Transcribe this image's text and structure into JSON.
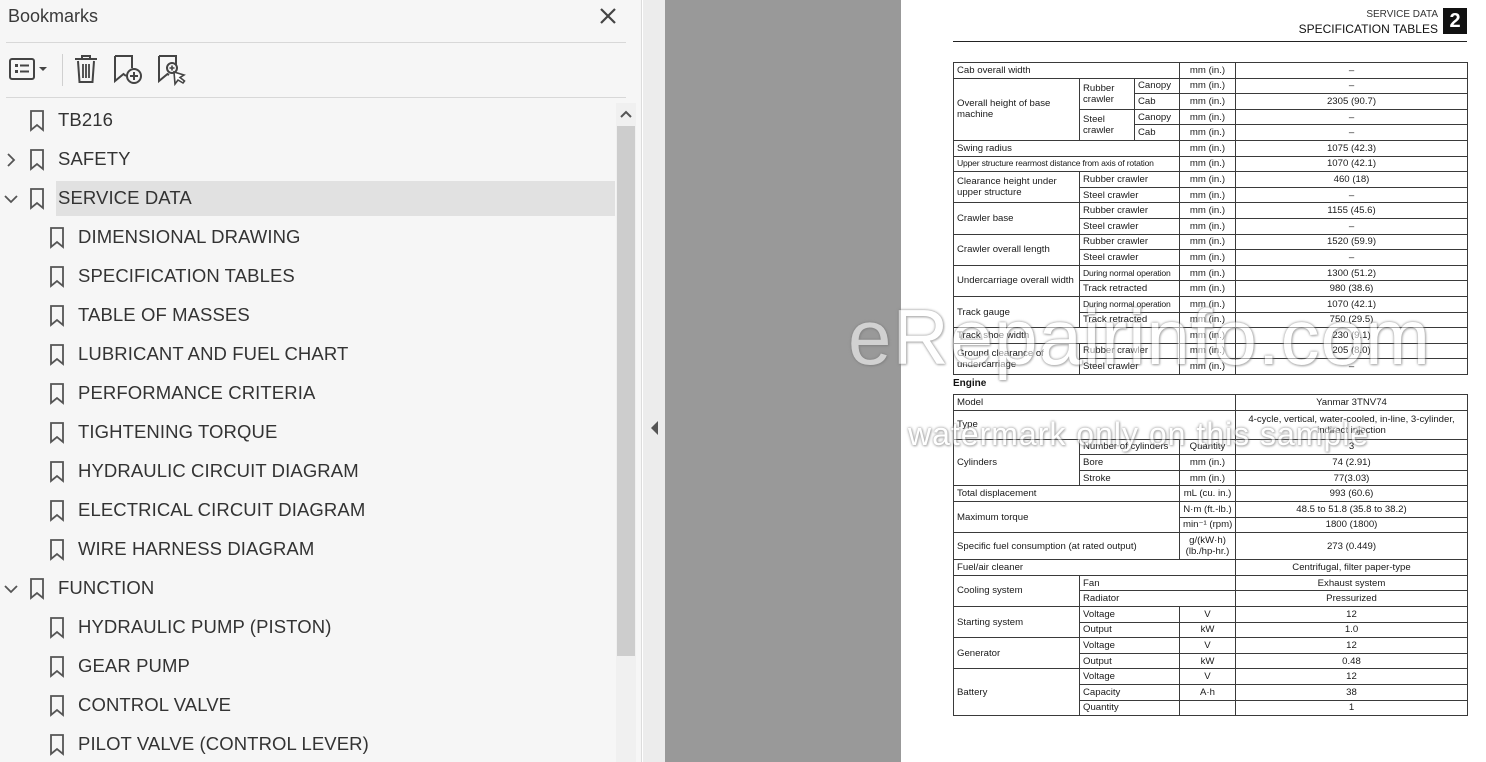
{
  "panel": {
    "title": "Bookmarks",
    "toolbar": {
      "options": "options-menu-icon",
      "delete": "trash-icon",
      "new_bookmark": "bookmark-add-icon",
      "find_bookmark": "bookmark-find-icon"
    }
  },
  "bookmarks": [
    {
      "label": "TB216",
      "level": 0,
      "twisty": "none",
      "selected": false
    },
    {
      "label": "SAFETY",
      "level": 0,
      "twisty": "collapsed",
      "selected": false
    },
    {
      "label": "SERVICE DATA",
      "level": 0,
      "twisty": "expanded",
      "selected": true
    },
    {
      "label": "DIMENSIONAL DRAWING",
      "level": 1,
      "twisty": "none",
      "selected": false
    },
    {
      "label": "SPECIFICATION TABLES",
      "level": 1,
      "twisty": "none",
      "selected": false
    },
    {
      "label": "TABLE OF MASSES",
      "level": 1,
      "twisty": "none",
      "selected": false
    },
    {
      "label": "LUBRICANT AND FUEL CHART",
      "level": 1,
      "twisty": "none",
      "selected": false
    },
    {
      "label": "PERFORMANCE CRITERIA",
      "level": 1,
      "twisty": "none",
      "selected": false
    },
    {
      "label": "TIGHTENING TORQUE",
      "level": 1,
      "twisty": "none",
      "selected": false
    },
    {
      "label": "HYDRAULIC CIRCUIT DIAGRAM",
      "level": 1,
      "twisty": "none",
      "selected": false
    },
    {
      "label": "ELECTRICAL CIRCUIT DIAGRAM",
      "level": 1,
      "twisty": "none",
      "selected": false
    },
    {
      "label": "WIRE HARNESS DIAGRAM",
      "level": 1,
      "twisty": "none",
      "selected": false
    },
    {
      "label": "FUNCTION",
      "level": 0,
      "twisty": "expanded",
      "selected": false
    },
    {
      "label": "HYDRAULIC PUMP (PISTON)",
      "level": 1,
      "twisty": "none",
      "selected": false
    },
    {
      "label": "GEAR PUMP",
      "level": 1,
      "twisty": "none",
      "selected": false
    },
    {
      "label": "CONTROL VALVE",
      "level": 1,
      "twisty": "none",
      "selected": false
    },
    {
      "label": "PILOT VALVE (CONTROL LEVER)",
      "level": 1,
      "twisty": "none",
      "selected": false
    }
  ],
  "document": {
    "section_label": "SERVICE DATA",
    "section_title": "SPECIFICATION TABLES",
    "section_number": "2",
    "engine_heading": "Engine",
    "watermark_main": "eRepairinfo.com",
    "watermark_sub": "watermark only on this sample",
    "dims": {
      "cab_overall_width": {
        "label": "Cab overall width",
        "unit": "mm (in.)",
        "value": "–"
      },
      "overall_height": {
        "label": "Overall height of base machine",
        "rubber": "Rubber crawler",
        "steel": "Steel crawler",
        "canopy": "Canopy",
        "cab": "Cab",
        "unit": "mm (in.)",
        "rubber_canopy": "–",
        "rubber_cab": "2305 (90.7)",
        "steel_canopy": "–",
        "steel_cab": "–"
      },
      "swing_radius": {
        "label": "Swing radius",
        "unit": "mm (in.)",
        "value": "1075 (42.3)"
      },
      "upper_rearmost": {
        "label": "Upper structure rearmost distance from axis of rotation",
        "unit": "mm (in.)",
        "value": "1070 (42.1)"
      },
      "clearance_upper": {
        "label": "Clearance height under upper structure",
        "rubber": "Rubber crawler",
        "steel": "Steel crawler",
        "unit": "mm (in.)",
        "rubber_value": "460 (18)",
        "steel_value": "–"
      },
      "crawler_base": {
        "label": "Crawler base",
        "rubber": "Rubber crawler",
        "steel": "Steel crawler",
        "unit": "mm (in.)",
        "rubber_value": "1155 (45.6)",
        "steel_value": "–"
      },
      "crawler_length": {
        "label": "Crawler overall length",
        "rubber": "Rubber crawler",
        "steel": "Steel crawler",
        "unit": "mm (in.)",
        "rubber_value": "1520 (59.9)",
        "steel_value": "–"
      },
      "undercarriage_width": {
        "label": "Undercarriage overall width",
        "normal": "During normal operation",
        "retracted": "Track retracted",
        "unit": "mm (in.)",
        "normal_value": "1300 (51.2)",
        "retracted_value": "980 (38.6)"
      },
      "track_gauge": {
        "label": "Track gauge",
        "normal": "During normal operation",
        "retracted": "Track retracted",
        "unit": "mm (in.)",
        "normal_value": "1070 (42.1)",
        "retracted_value": "750 (29.5)"
      },
      "track_shoe_width": {
        "label": "Track shoe width",
        "unit": "mm (in.)",
        "value": "230 (9.1)"
      },
      "ground_clearance": {
        "label": "Ground clearance of undercarriage",
        "rubber": "Rubber crawler",
        "steel": "Steel crawler",
        "unit": "mm (in.)",
        "rubber_value": "205 (8.0)",
        "steel_value": "–"
      }
    },
    "engine": {
      "model": {
        "label": "Model",
        "value": "Yanmar 3TNV74"
      },
      "type": {
        "label": "Type",
        "value": "4-cycle, vertical, water-cooled, in-line, 3-cylinder, indirect injection"
      },
      "cylinders": {
        "label": "Cylinders",
        "number": "Number of cylinders",
        "number_unit": "Quantity",
        "number_value": "3",
        "bore": "Bore",
        "bore_unit": "mm (in.)",
        "bore_value": "74 (2.91)",
        "stroke": "Stroke",
        "stroke_unit": "mm (in.)",
        "stroke_value": "77(3.03)"
      },
      "displacement": {
        "label": "Total displacement",
        "unit": "mL (cu. in.)",
        "value": "993 (60.6)"
      },
      "torque": {
        "label": "Maximum torque",
        "unit1": "N·m (ft.-lb.)",
        "value1": "48.5 to 51.8 (35.8 to 38.2)",
        "unit2": "min⁻¹ (rpm)",
        "value2": "1800 (1800)"
      },
      "fuel_consumption": {
        "label": "Specific fuel consumption (at rated output)",
        "unit_line1": "g/(kW·h)",
        "unit_line2": "(lb./hp-hr.)",
        "value": "273 (0.449)"
      },
      "air_cleaner": {
        "label": "Fuel/air cleaner",
        "value": "Centrifugal, filter paper-type"
      },
      "cooling": {
        "label": "Cooling system",
        "fan": "Fan",
        "fan_value": "Exhaust system",
        "radiator": "Radiator",
        "radiator_value": "Pressurized"
      },
      "starting": {
        "label": "Starting system",
        "voltage": "Voltage",
        "voltage_unit": "V",
        "voltage_value": "12",
        "output": "Output",
        "output_unit": "kW",
        "output_value": "1.0"
      },
      "generator": {
        "label": "Generator",
        "voltage": "Voltage",
        "voltage_unit": "V",
        "voltage_value": "12",
        "output": "Output",
        "output_unit": "kW",
        "output_value": "0.48"
      },
      "battery": {
        "label": "Battery",
        "voltage": "Voltage",
        "voltage_unit": "V",
        "voltage_value": "12",
        "capacity": "Capacity",
        "capacity_unit": "A·h",
        "capacity_value": "38",
        "quantity": "Quantity",
        "quantity_value": "1"
      }
    }
  }
}
